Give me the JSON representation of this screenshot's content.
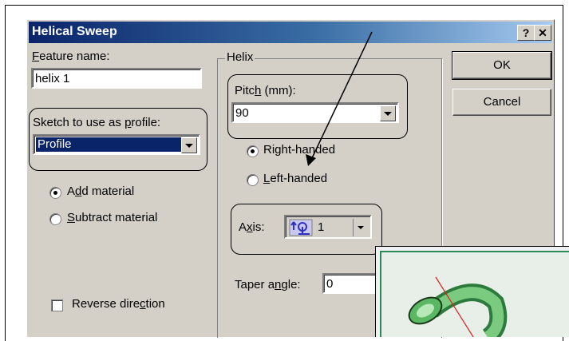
{
  "dialog": {
    "title": "Helical Sweep",
    "help_button": "?",
    "close_button": "✕"
  },
  "feature_name": {
    "label_pre": "",
    "label_ul": "F",
    "label_post": "eature name:",
    "value": "helix 1"
  },
  "sketch": {
    "label_pre": "Sketch to use as ",
    "label_ul": "p",
    "label_post": "rofile:",
    "value": "Profile"
  },
  "material": {
    "add_pre": "A",
    "add_ul": "d",
    "add_post": "d material",
    "subtract_pre": "",
    "subtract_ul": "S",
    "subtract_post": "ubtract material",
    "selected": "add"
  },
  "reverse": {
    "label_pre": "Reverse dire",
    "label_ul": "c",
    "label_post": "tion",
    "checked": false
  },
  "helix": {
    "group_label": "Helix",
    "pitch_pre": "Pitc",
    "pitch_ul": "h",
    "pitch_post": " (mm):",
    "pitch_value": "90",
    "right_pre": "Ri",
    "right_ul": "g",
    "right_post": "ht-handed",
    "left_pre": "",
    "left_ul": "L",
    "left_post": "eft-handed",
    "handedness": "right",
    "axis_pre": "A",
    "axis_ul": "x",
    "axis_post": "is:",
    "axis_value": "1",
    "taper_pre": "Taper a",
    "taper_ul": "n",
    "taper_post": "gle:",
    "taper_value": "0"
  },
  "buttons": {
    "ok": "OK",
    "cancel": "Cancel"
  },
  "colors": {
    "title_start": "#0a246a",
    "title_end": "#a6caf0",
    "selection": "#0a246a",
    "dialog_bg": "#d4d0c8",
    "axis_icon": "#3030c0",
    "preview_model": "#3aa650",
    "annotation_arrow": "#000000",
    "preview_line": "#e02020"
  }
}
